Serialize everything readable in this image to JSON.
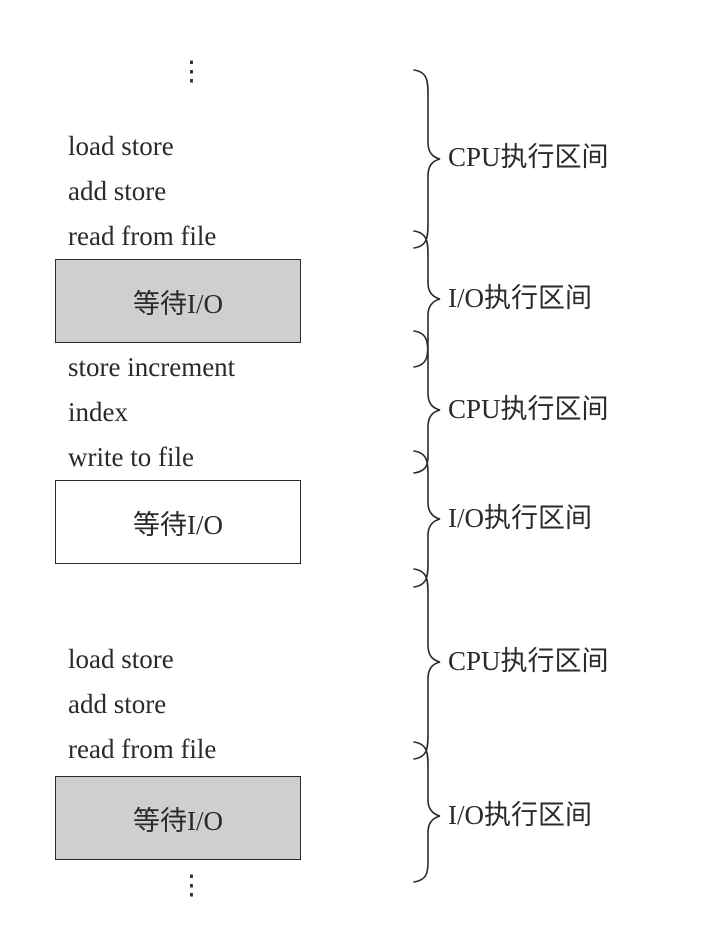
{
  "ellipsis": "⋮",
  "blocks": [
    {
      "kind": "cpu",
      "lines": [
        "load store",
        "add store",
        "read from file"
      ],
      "label": "CPU执行区间"
    },
    {
      "kind": "io",
      "box_text": "等待I/O",
      "fill": "#cfcfcf",
      "label": "I/O执行区间"
    },
    {
      "kind": "cpu",
      "lines": [
        "store increment",
        "index",
        "write to file"
      ],
      "label": "CPU执行区间"
    },
    {
      "kind": "io",
      "box_text": "等待I/O",
      "fill": "#ffffff",
      "label": "I/O执行区间"
    },
    {
      "kind": "cpu",
      "lines": [
        "load store",
        "add store",
        "read from file"
      ],
      "label": "CPU执行区间"
    },
    {
      "kind": "io",
      "box_text": "等待I/O",
      "fill": "#cfcfcf",
      "label": "I/O执行区间"
    }
  ]
}
